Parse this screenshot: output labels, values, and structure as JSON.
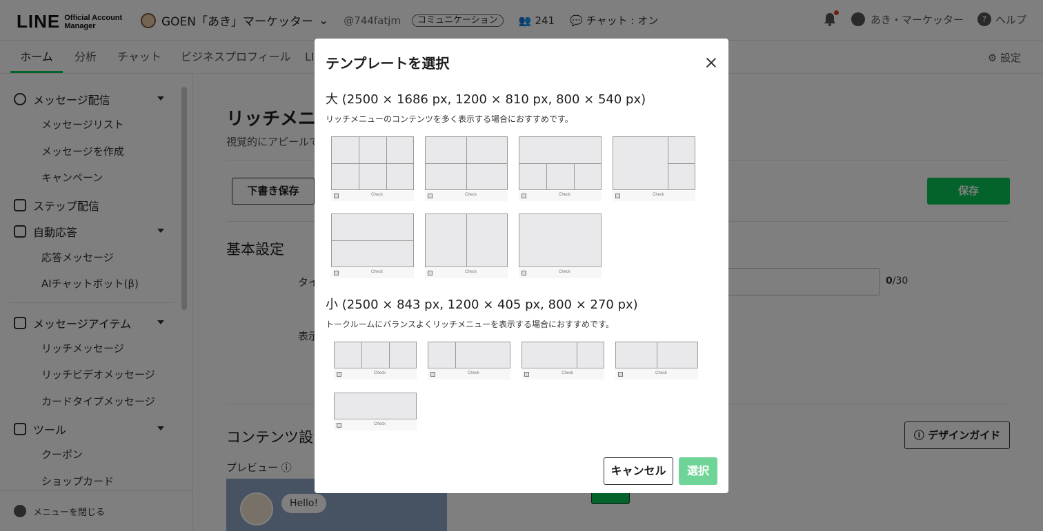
{
  "header": {
    "logo": "LINE",
    "logo_sub_1": "Official Account",
    "logo_sub_2": "Manager",
    "account_name": "GOEN「あき」マーケッター",
    "account_id": "@744fatjm",
    "badge": "コミュニケーション",
    "friends": "241",
    "chat_status": "チャット : オン",
    "user_name": "あき・マーケッター",
    "help": "ヘルプ"
  },
  "nav": {
    "tabs": [
      "ホーム",
      "分析",
      "チャット",
      "ビジネスプロフィール",
      "LI"
    ],
    "settings": "設定"
  },
  "sidebar": {
    "sections": [
      {
        "label": "メッセージ配信",
        "items": [
          "メッセージリスト",
          "メッセージを作成",
          "キャンペーン"
        ]
      },
      {
        "label": "ステップ配信"
      },
      {
        "label": "自動応答",
        "items": [
          "応答メッセージ",
          "AIチャットボット(β)"
        ]
      },
      {
        "label": "メッセージアイテム",
        "items": [
          "リッチメッセージ",
          "リッチビデオメッセージ",
          "カードタイプメッセージ"
        ]
      },
      {
        "label": "ツール",
        "items": [
          "クーポン",
          "ショップカード"
        ]
      }
    ],
    "close_menu": "メニューを閉じる"
  },
  "page": {
    "title": "リッチメニ",
    "desc": "視覚的にアピールで",
    "draft_button": "下書き保存",
    "save_button": "保存",
    "basic_settings": "基本設定",
    "title_label": "タイ",
    "display_label": "表示",
    "char_count": "0",
    "char_max": "/30",
    "content_settings": "コンテンツ設",
    "design_guide": "デザインガイド",
    "preview": "プレビュー",
    "hello": "Hello!"
  },
  "modal": {
    "title": "テンプレートを選択",
    "large_heading": "大 (2500 × 1686 px, 1200 × 810 px, 800 × 540 px)",
    "large_desc": "リッチメニューのコンテンツを多く表示する場合におすすめです。",
    "small_heading": "小 (2500 × 843 px, 1200 × 405 px, 800 × 270 px)",
    "small_desc": "トークルームにバランスよくリッチメニューを表示する場合におすすめです。",
    "check_label": "Check",
    "cancel": "キャンセル",
    "select": "選択"
  }
}
